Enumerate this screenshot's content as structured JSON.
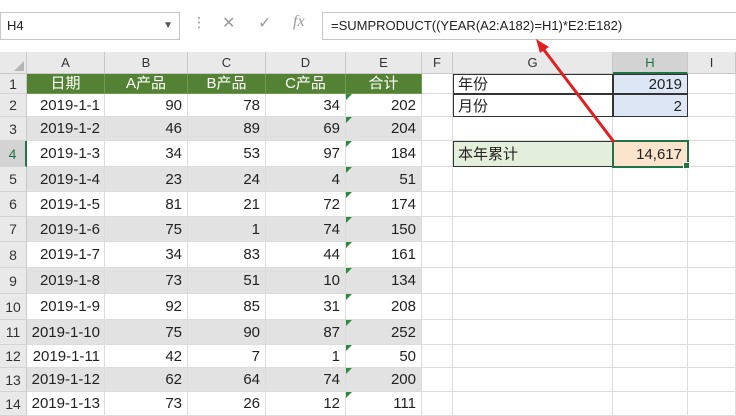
{
  "name_box": "H4",
  "formula": "=SUMPRODUCT((YEAR(A2:A182)=H1)*E2:E182)",
  "columns": [
    "A",
    "B",
    "C",
    "D",
    "E",
    "F",
    "G",
    "H",
    "I"
  ],
  "rows": [
    "1",
    "2",
    "3",
    "4",
    "5",
    "6",
    "7",
    "8",
    "9",
    "10",
    "11",
    "12",
    "13",
    "14"
  ],
  "table": {
    "headers": [
      "日期",
      "A产品",
      "B产品",
      "C产品",
      "合计"
    ],
    "rows": [
      [
        "2019-1-1",
        "90",
        "78",
        "34",
        "202"
      ],
      [
        "2019-1-2",
        "46",
        "89",
        "69",
        "204"
      ],
      [
        "2019-1-3",
        "34",
        "53",
        "97",
        "184"
      ],
      [
        "2019-1-4",
        "23",
        "24",
        "4",
        "51"
      ],
      [
        "2019-1-5",
        "81",
        "21",
        "72",
        "174"
      ],
      [
        "2019-1-6",
        "75",
        "1",
        "74",
        "150"
      ],
      [
        "2019-1-7",
        "34",
        "83",
        "44",
        "161"
      ],
      [
        "2019-1-8",
        "73",
        "51",
        "10",
        "134"
      ],
      [
        "2019-1-9",
        "92",
        "85",
        "31",
        "208"
      ],
      [
        "2019-1-10",
        "75",
        "90",
        "87",
        "252"
      ],
      [
        "2019-1-11",
        "42",
        "7",
        "1",
        "50"
      ],
      [
        "2019-1-12",
        "62",
        "64",
        "74",
        "200"
      ],
      [
        "2019-1-13",
        "73",
        "26",
        "12",
        "111"
      ]
    ]
  },
  "side": {
    "year_label": "年份",
    "year_value": "2019",
    "month_label": "月份",
    "month_value": "2",
    "total_label": "本年累计",
    "total_value": "14,617"
  }
}
